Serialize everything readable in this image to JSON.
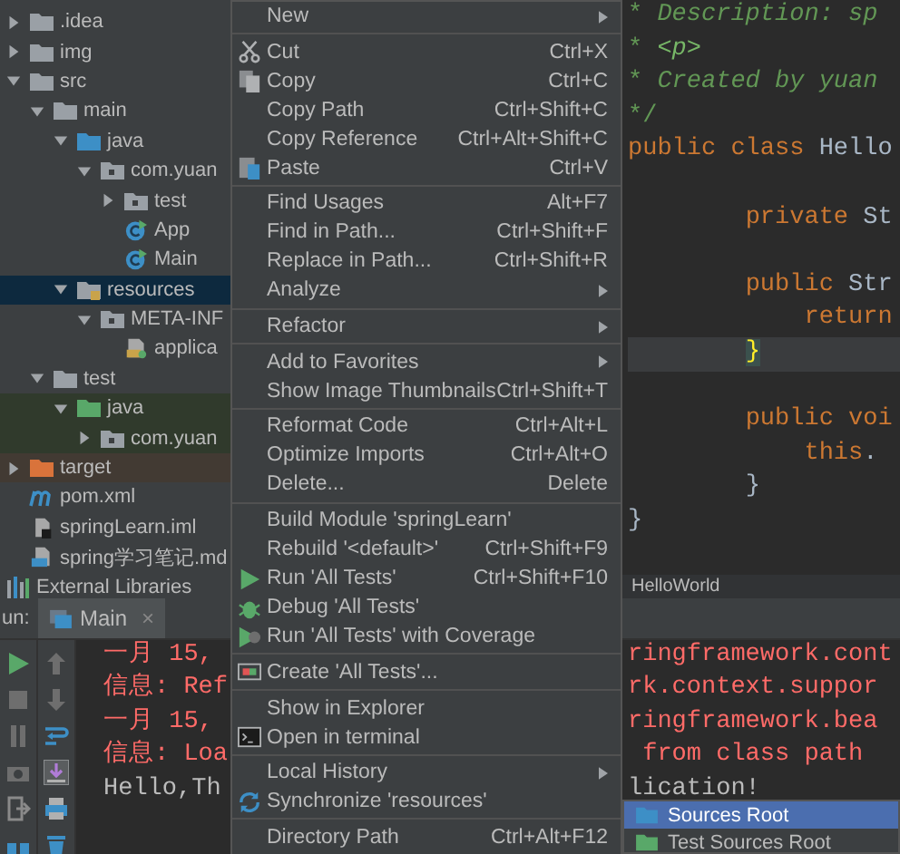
{
  "project_tree": {
    "items": [
      {
        "label": ".idea",
        "kind": "folder",
        "selected": false,
        "expanded": false
      },
      {
        "label": "img",
        "kind": "folder",
        "selected": false,
        "expanded": false
      },
      {
        "label": "src",
        "kind": "folder",
        "selected": false,
        "expanded": true,
        "children": [
          {
            "label": "main",
            "kind": "folder",
            "selected": false,
            "expanded": true,
            "children": [
              {
                "label": "java",
                "kind": "source-folder",
                "selected": false,
                "expanded": true,
                "children": [
                  {
                    "label": "com.yuan",
                    "kind": "package",
                    "selected": false,
                    "expanded": true,
                    "children": [
                      {
                        "label": "test",
                        "kind": "package",
                        "selected": false,
                        "expanded": false
                      },
                      {
                        "label": "App",
                        "kind": "class",
                        "selected": false
                      },
                      {
                        "label": "Main",
                        "kind": "class",
                        "selected": false
                      }
                    ]
                  }
                ]
              },
              {
                "label": "resources",
                "kind": "resources-folder",
                "selected": true,
                "expanded": true,
                "children": [
                  {
                    "label": "META-INF",
                    "kind": "package",
                    "selected": false,
                    "expanded": true,
                    "children": [
                      {
                        "label": "applica",
                        "kind": "config-file",
                        "selected": false
                      }
                    ]
                  }
                ]
              }
            ]
          },
          {
            "label": "test",
            "kind": "folder",
            "selected": false,
            "expanded": true,
            "children": [
              {
                "label": "java",
                "kind": "test-folder",
                "selected": false,
                "expanded": true,
                "children": [
                  {
                    "label": "com.yuan",
                    "kind": "package",
                    "selected": false,
                    "expanded": false
                  }
                ]
              }
            ]
          }
        ]
      },
      {
        "label": "target",
        "kind": "excluded-folder",
        "selected": false,
        "expanded": false
      },
      {
        "label": "pom.xml",
        "kind": "maven-file",
        "selected": false
      },
      {
        "label": "springLearn.iml",
        "kind": "module-file",
        "selected": false
      },
      {
        "label": "spring学习笔记.md",
        "kind": "markdown-file",
        "selected": false
      },
      {
        "label": "External Libraries",
        "kind": "libraries",
        "selected": false
      }
    ]
  },
  "editor": {
    "lines": [
      {
        "current": false,
        "tokens": [
          {
            "t": "* ",
            "kind": "comment-star"
          },
          {
            "t": "Description: sp",
            "kind": "comment"
          }
        ]
      },
      {
        "current": false,
        "tokens": [
          {
            "t": "* ",
            "kind": "comment-star"
          },
          {
            "t": "<p>",
            "kind": "comment-tag"
          }
        ]
      },
      {
        "current": false,
        "tokens": [
          {
            "t": "* ",
            "kind": "comment-star"
          },
          {
            "t": "Created by yuan",
            "kind": "comment"
          }
        ]
      },
      {
        "current": false,
        "tokens": [
          {
            "t": "*/",
            "kind": "comment-star"
          }
        ]
      },
      {
        "current": false,
        "tokens": [
          {
            "t": "public class ",
            "kind": "keyword"
          },
          {
            "t": "Hello",
            "kind": "plain"
          }
        ]
      },
      {
        "current": false
      },
      {
        "current": false,
        "tokens": [
          {
            "t": "        private ",
            "kind": "keyword"
          },
          {
            "t": "St",
            "kind": "plain"
          }
        ]
      },
      {
        "current": false
      },
      {
        "current": false,
        "tokens": [
          {
            "t": "        public ",
            "kind": "keyword"
          },
          {
            "t": "Str",
            "kind": "plain"
          }
        ]
      },
      {
        "current": false,
        "tokens": [
          {
            "t": "            return",
            "kind": "keyword"
          }
        ]
      },
      {
        "current": true,
        "tokens": [
          {
            "t": "        }",
            "kind": "brace-match"
          }
        ]
      },
      {
        "current": false
      },
      {
        "current": false,
        "tokens": [
          {
            "t": "        public ",
            "kind": "keyword"
          },
          {
            "t": "voi",
            "kind": "keyword"
          }
        ]
      },
      {
        "current": false,
        "tokens": [
          {
            "t": "            this",
            "kind": "keyword"
          },
          {
            "t": ".",
            "kind": "plain"
          }
        ]
      },
      {
        "current": false,
        "tokens": [
          {
            "t": "        }",
            "kind": "plain"
          }
        ]
      },
      {
        "current": false,
        "tokens": [
          {
            "t": "}",
            "kind": "plain"
          }
        ]
      }
    ],
    "breadcrumb": "HelloWorld"
  },
  "run_panel": {
    "label": "un:",
    "tabs": [
      {
        "label": "Main",
        "close": "×",
        "selected": true
      }
    ],
    "tools": [
      {
        "kind": "rerun"
      },
      {
        "kind": "stop"
      },
      {
        "kind": "pause"
      },
      {
        "kind": "dump"
      },
      {
        "kind": "exit"
      },
      {
        "kind": "layout"
      }
    ],
    "console_tools": [
      {
        "kind": "up",
        "on": false
      },
      {
        "kind": "down",
        "on": false
      },
      {
        "kind": "wrap",
        "on": false
      },
      {
        "kind": "scroll-end",
        "on": true
      },
      {
        "kind": "print",
        "on": false
      },
      {
        "kind": "trash",
        "on": false
      }
    ],
    "console": [
      {
        "kind": "error",
        "left": "一月 15,",
        "right": "ringframework.cont"
      },
      {
        "kind": "error",
        "left": "信息: Ref",
        "right": "rk.context.suppor"
      },
      {
        "kind": "error",
        "left": "一月 15,",
        "right": "ringframework.bea"
      },
      {
        "kind": "error",
        "left": "信息: Loa",
        "right": " from class path"
      },
      {
        "kind": "output",
        "left": "Hello,Th",
        "right": "lication!"
      }
    ]
  },
  "context_menu": {
    "groups": [
      [
        {
          "label": "New",
          "kind": "plain",
          "submenu": true
        }
      ],
      [
        {
          "label": "Cut",
          "kind": "cut",
          "shortcut": "Ctrl+X",
          "submenu": false
        },
        {
          "label": "Copy",
          "kind": "copy",
          "shortcut": "Ctrl+C",
          "submenu": false
        },
        {
          "label": "Copy Path",
          "kind": "plain",
          "shortcut": "Ctrl+Shift+C",
          "submenu": false
        },
        {
          "label": "Copy Reference",
          "kind": "plain",
          "shortcut": "Ctrl+Alt+Shift+C",
          "submenu": false
        },
        {
          "label": "Paste",
          "kind": "paste",
          "shortcut": "Ctrl+V",
          "submenu": false
        }
      ],
      [
        {
          "label": "Find Usages",
          "kind": "plain",
          "shortcut": "Alt+F7",
          "submenu": false
        },
        {
          "label": "Find in Path...",
          "kind": "plain",
          "shortcut": "Ctrl+Shift+F",
          "submenu": false
        },
        {
          "label": "Replace in Path...",
          "kind": "plain",
          "shortcut": "Ctrl+Shift+R",
          "submenu": false
        },
        {
          "label": "Analyze",
          "kind": "plain",
          "submenu": true
        }
      ],
      [
        {
          "label": "Refactor",
          "kind": "plain",
          "submenu": true
        }
      ],
      [
        {
          "label": "Add to Favorites",
          "kind": "plain",
          "submenu": true
        },
        {
          "label": "Show Image Thumbnails",
          "kind": "plain",
          "shortcut": "Ctrl+Shift+T",
          "submenu": false
        }
      ],
      [
        {
          "label": "Reformat Code",
          "kind": "plain",
          "shortcut": "Ctrl+Alt+L",
          "submenu": false
        },
        {
          "label": "Optimize Imports",
          "kind": "plain",
          "shortcut": "Ctrl+Alt+O",
          "submenu": false
        },
        {
          "label": "Delete...",
          "kind": "plain",
          "shortcut": "Delete",
          "submenu": false
        }
      ],
      [
        {
          "label": "Build Module 'springLearn'",
          "kind": "plain",
          "submenu": false
        },
        {
          "label": "Rebuild '<default>'",
          "kind": "plain",
          "shortcut": "Ctrl+Shift+F9",
          "submenu": false
        },
        {
          "label": "Run 'All Tests'",
          "kind": "run",
          "shortcut": "Ctrl+Shift+F10",
          "submenu": false
        },
        {
          "label": "Debug 'All Tests'",
          "kind": "debug",
          "submenu": false
        },
        {
          "label": "Run 'All Tests' with Coverage",
          "kind": "coverage",
          "submenu": false
        }
      ],
      [
        {
          "label": "Create 'All Tests'...",
          "kind": "create-test",
          "submenu": false
        }
      ],
      [
        {
          "label": "Show in Explorer",
          "kind": "plain",
          "submenu": false
        },
        {
          "label": "Open in terminal",
          "kind": "terminal",
          "submenu": false
        }
      ],
      [
        {
          "label": "Local History",
          "kind": "plain",
          "submenu": true
        },
        {
          "label": "Synchronize 'resources'",
          "kind": "sync",
          "submenu": false
        }
      ],
      [
        {
          "label": "Directory Path",
          "kind": "plain",
          "shortcut": "Ctrl+Alt+F12",
          "submenu": false
        }
      ]
    ]
  },
  "submenu": {
    "items": [
      {
        "label": "Sources Root",
        "kind": "source-folder",
        "selected": true
      },
      {
        "label": "Test Sources Root",
        "kind": "test-folder",
        "selected": false
      }
    ]
  }
}
